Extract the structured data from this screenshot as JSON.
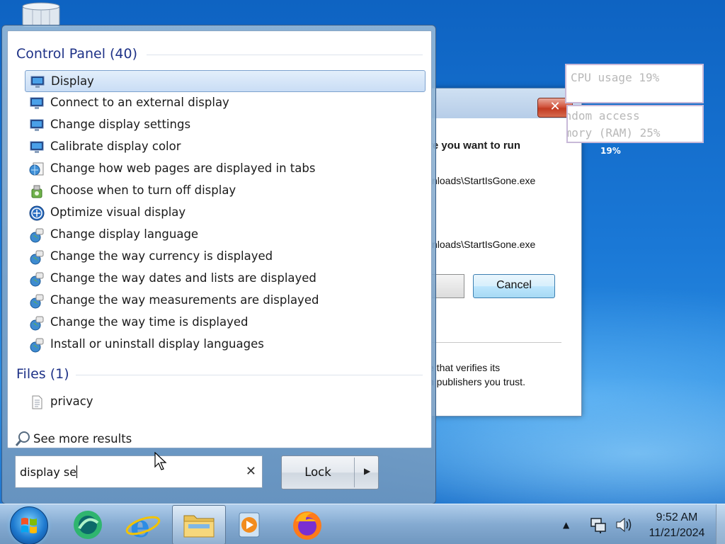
{
  "uac": {
    "question": "re you want to run",
    "path1": "ynloads\\StartIsGone.exe",
    "path2": "ynloads\\StartIsGone.exe",
    "cancel_label": "Cancel",
    "footer1": "e that verifies its",
    "footer2": "n publishers you trust.",
    "close_glyph": "✕"
  },
  "gadgets": {
    "cpu": "CPU usage 19%",
    "ram_line1": "andom access",
    "ram_line2": "emory (RAM) 25%",
    "ram_pct": "19%"
  },
  "start_menu": {
    "groups": {
      "control_panel": "Control Panel (40)",
      "files": "Files (1)"
    },
    "items": [
      {
        "label": "Display",
        "icon": "monitor-icon",
        "selected": true
      },
      {
        "label": "Connect to an external display",
        "icon": "monitor-icon"
      },
      {
        "label": "Change display settings",
        "icon": "monitor-icon"
      },
      {
        "label": "Calibrate display color",
        "icon": "monitor-icon"
      },
      {
        "label": "Change how web pages are displayed in tabs",
        "icon": "internet-options-icon"
      },
      {
        "label": "Choose when to turn off display",
        "icon": "power-options-icon"
      },
      {
        "label": "Optimize visual display",
        "icon": "ease-of-access-icon"
      },
      {
        "label": "Change display language",
        "icon": "region-globe-icon"
      },
      {
        "label": "Change the way currency is displayed",
        "icon": "region-globe-icon"
      },
      {
        "label": "Change the way dates and lists are displayed",
        "icon": "region-globe-icon"
      },
      {
        "label": "Change the way measurements are displayed",
        "icon": "region-globe-icon"
      },
      {
        "label": "Change the way time is displayed",
        "icon": "region-globe-icon"
      },
      {
        "label": "Install or uninstall display languages",
        "icon": "region-globe-icon"
      }
    ],
    "files": [
      {
        "label": "privacy",
        "icon": "text-file-icon"
      }
    ],
    "see_more": "See more results",
    "search": {
      "value": "display se",
      "clear_glyph": "✕"
    },
    "lock_label": "Lock",
    "lock_arrow": "▶"
  },
  "taskbar": {
    "time": "9:52 AM",
    "date": "11/21/2024",
    "tray_arrow": "▲"
  },
  "colors": {
    "accent": "#1e3287",
    "selection": "#c9ddf5",
    "desktop": "#1a78d6"
  }
}
